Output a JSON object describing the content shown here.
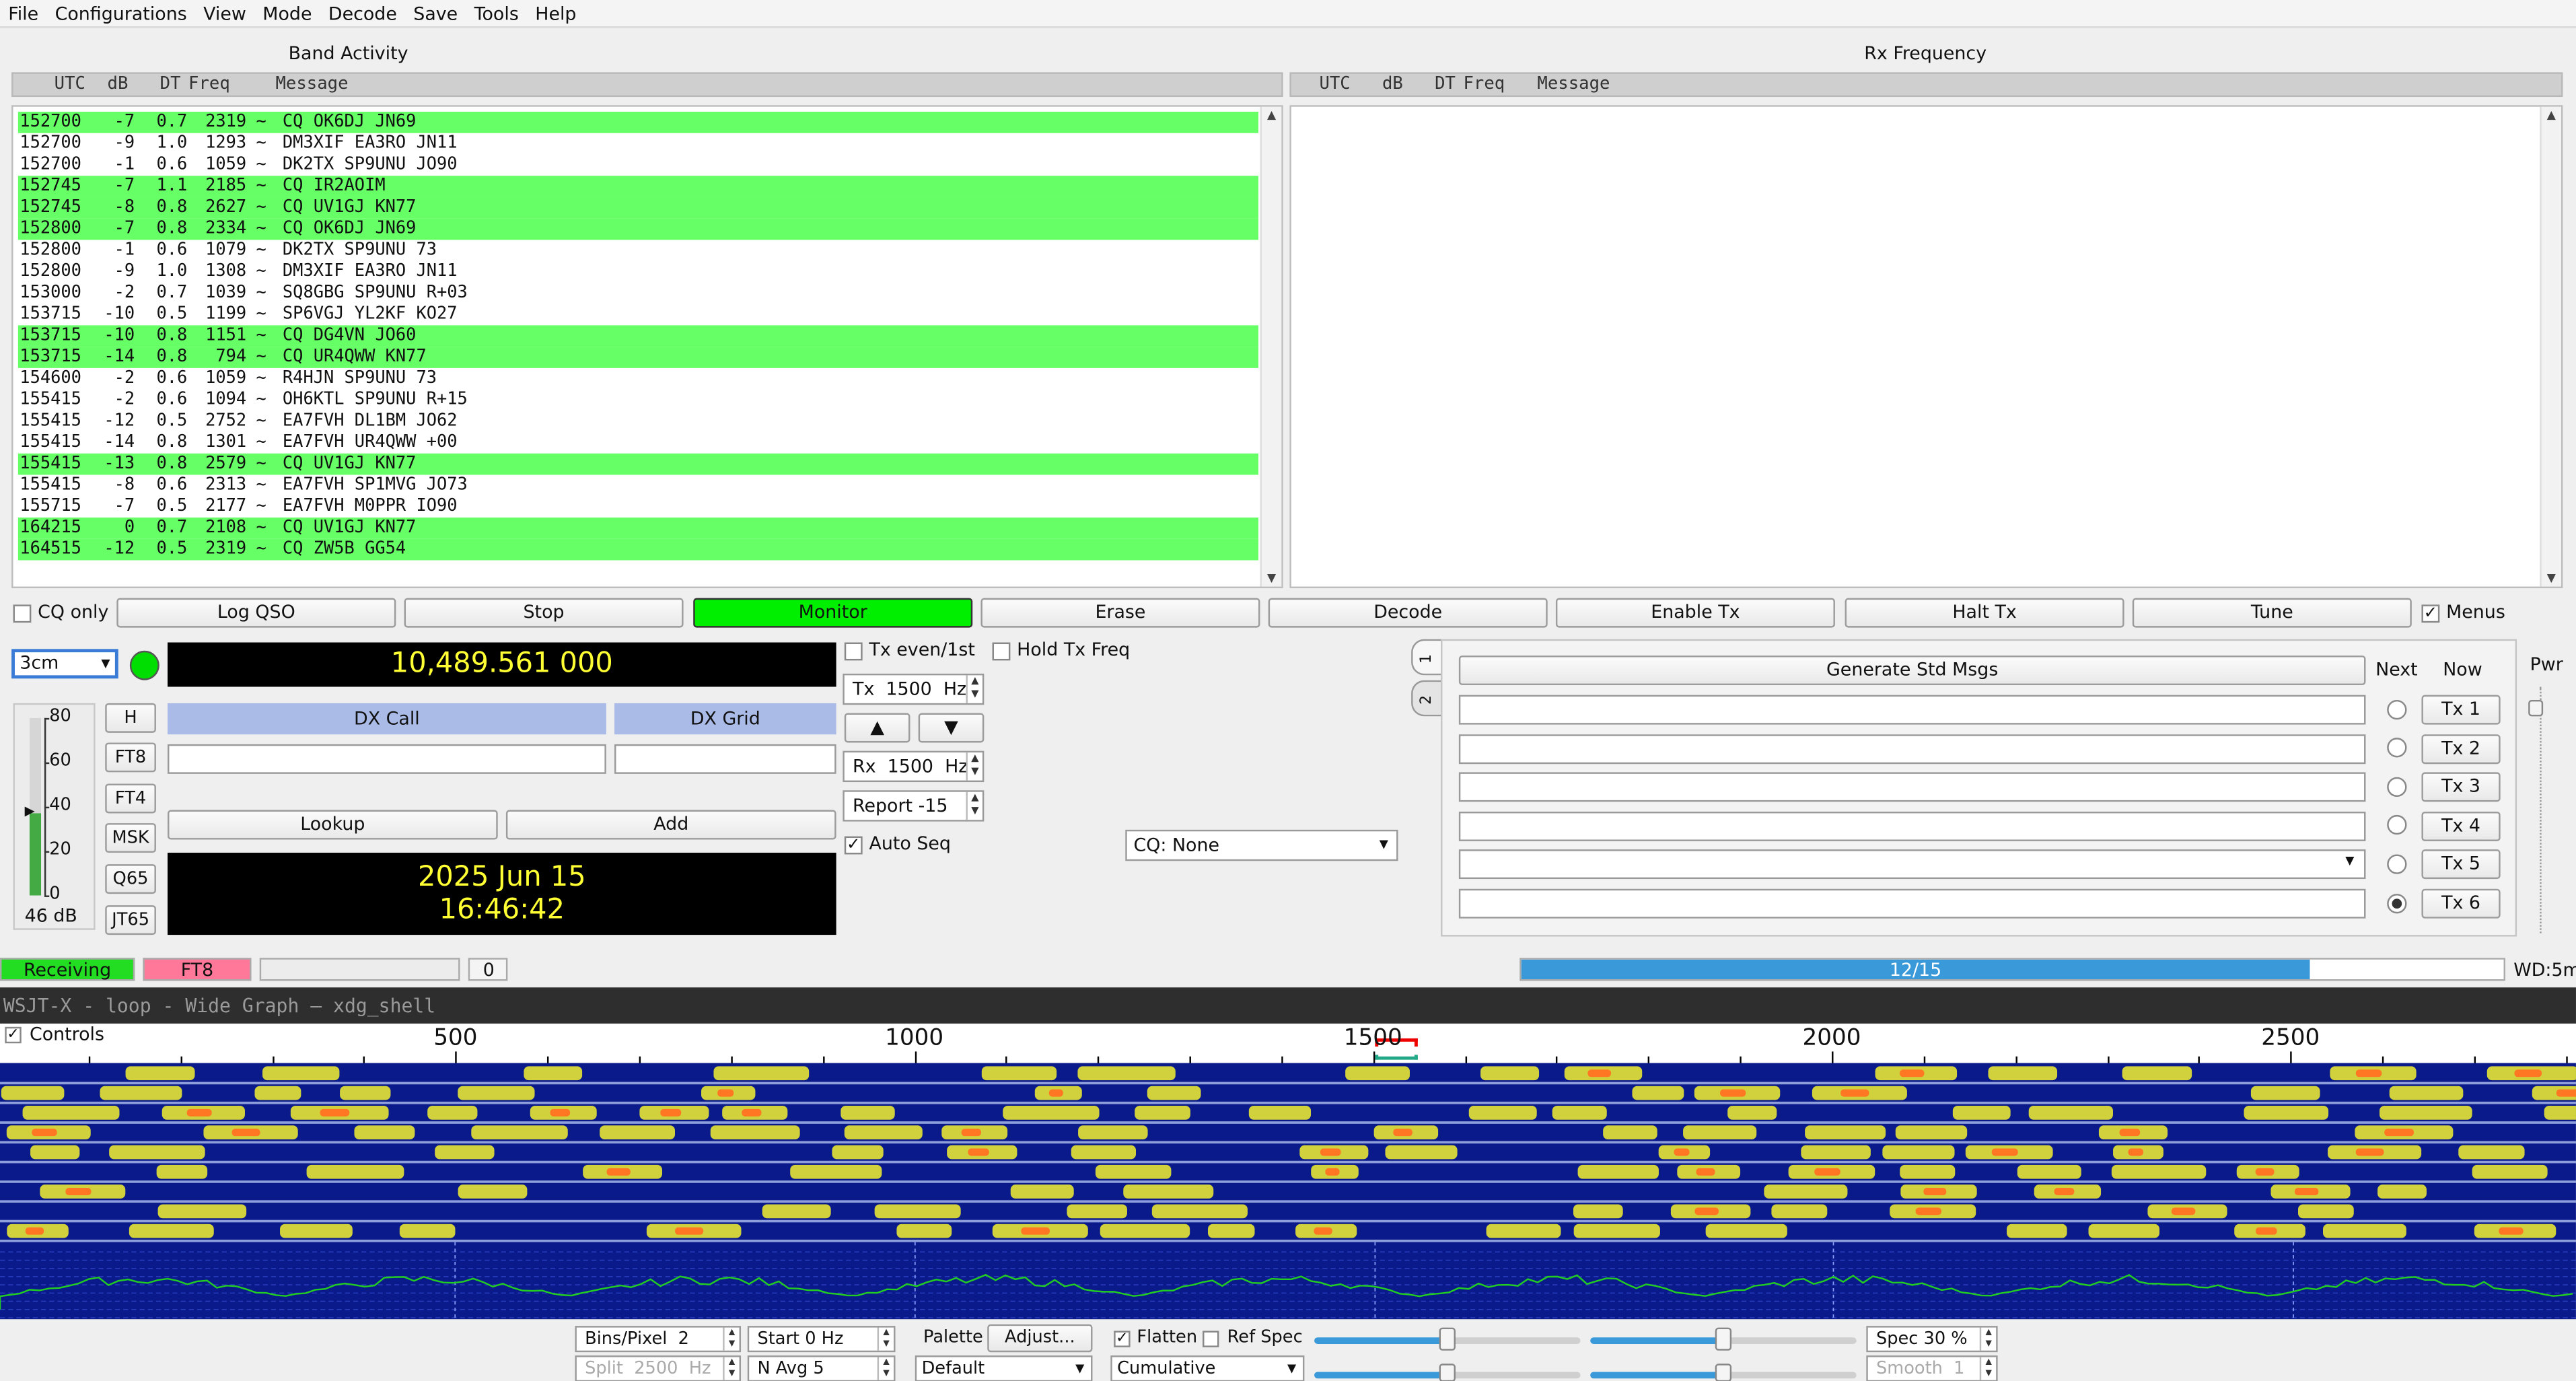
{
  "menu": [
    "File",
    "Configurations",
    "View",
    "Mode",
    "Decode",
    "Save",
    "Tools",
    "Help"
  ],
  "band_activity": {
    "title": "Band Activity",
    "headers": {
      "utc": "UTC",
      "db": "dB",
      "dt": "DT",
      "freq": "Freq",
      "message": "Message"
    },
    "rows": [
      {
        "utc": "152700",
        "db": "-7",
        "dt": "0.7",
        "freq": "2319",
        "t": "~",
        "msg": "CQ OK6DJ JN69",
        "cq": true
      },
      {
        "utc": "152700",
        "db": "-9",
        "dt": "1.0",
        "freq": "1293",
        "t": "~",
        "msg": "DM3XIF EA3RO JN11",
        "cq": false
      },
      {
        "utc": "152700",
        "db": "-1",
        "dt": "0.6",
        "freq": "1059",
        "t": "~",
        "msg": "DK2TX SP9UNU JO90",
        "cq": false
      },
      {
        "utc": "152745",
        "db": "-7",
        "dt": "1.1",
        "freq": "2185",
        "t": "~",
        "msg": "CQ IR2AOIM",
        "cq": true
      },
      {
        "utc": "152745",
        "db": "-8",
        "dt": "0.8",
        "freq": "2627",
        "t": "~",
        "msg": "CQ UV1GJ KN77",
        "cq": true
      },
      {
        "utc": "152800",
        "db": "-7",
        "dt": "0.8",
        "freq": "2334",
        "t": "~",
        "msg": "CQ OK6DJ JN69",
        "cq": true
      },
      {
        "utc": "152800",
        "db": "-1",
        "dt": "0.6",
        "freq": "1079",
        "t": "~",
        "msg": "DK2TX SP9UNU 73",
        "cq": false
      },
      {
        "utc": "152800",
        "db": "-9",
        "dt": "1.0",
        "freq": "1308",
        "t": "~",
        "msg": "DM3XIF EA3RO JN11",
        "cq": false
      },
      {
        "utc": "153000",
        "db": "-2",
        "dt": "0.7",
        "freq": "1039",
        "t": "~",
        "msg": "SQ8GBG SP9UNU R+03",
        "cq": false
      },
      {
        "utc": "153715",
        "db": "-10",
        "dt": "0.5",
        "freq": "1199",
        "t": "~",
        "msg": "SP6VGJ YL2KF KO27",
        "cq": false
      },
      {
        "utc": "153715",
        "db": "-10",
        "dt": "0.8",
        "freq": "1151",
        "t": "~",
        "msg": "CQ DG4VN JO60",
        "cq": true
      },
      {
        "utc": "153715",
        "db": "-14",
        "dt": "0.8",
        "freq": "794",
        "t": "~",
        "msg": "CQ UR4QWW KN77",
        "cq": true
      },
      {
        "utc": "154600",
        "db": "-2",
        "dt": "0.6",
        "freq": "1059",
        "t": "~",
        "msg": "R4HJN SP9UNU 73",
        "cq": false
      },
      {
        "utc": "155415",
        "db": "-2",
        "dt": "0.6",
        "freq": "1094",
        "t": "~",
        "msg": "OH6KTL SP9UNU R+15",
        "cq": false
      },
      {
        "utc": "155415",
        "db": "-12",
        "dt": "0.5",
        "freq": "2752",
        "t": "~",
        "msg": "EA7FVH DL1BM JO62",
        "cq": false
      },
      {
        "utc": "155415",
        "db": "-14",
        "dt": "0.8",
        "freq": "1301",
        "t": "~",
        "msg": "EA7FVH UR4QWW +00",
        "cq": false
      },
      {
        "utc": "155415",
        "db": "-13",
        "dt": "0.8",
        "freq": "2579",
        "t": "~",
        "msg": "CQ UV1GJ KN77",
        "cq": true
      },
      {
        "utc": "155415",
        "db": "-8",
        "dt": "0.6",
        "freq": "2313",
        "t": "~",
        "msg": "EA7FVH SP1MVG JO73",
        "cq": false
      },
      {
        "utc": "155715",
        "db": "-7",
        "dt": "0.5",
        "freq": "2177",
        "t": "~",
        "msg": "EA7FVH M0PPR IO90",
        "cq": false
      },
      {
        "utc": "164215",
        "db": "0",
        "dt": "0.7",
        "freq": "2108",
        "t": "~",
        "msg": "CQ UV1GJ KN77",
        "cq": true
      },
      {
        "utc": "164515",
        "db": "-12",
        "dt": "0.5",
        "freq": "2319",
        "t": "~",
        "msg": "CQ ZW5B GG54",
        "cq": true
      }
    ]
  },
  "rx_frequency": {
    "title": "Rx Frequency",
    "headers": {
      "utc": "UTC",
      "db": "dB",
      "dt": "DT",
      "freq": "Freq",
      "message": "Message"
    }
  },
  "controls": {
    "cq_only": "CQ only",
    "log_qso": "Log QSO",
    "stop": "Stop",
    "monitor": "Monitor",
    "erase": "Erase",
    "decode": "Decode",
    "enable_tx": "Enable Tx",
    "halt_tx": "Halt Tx",
    "tune": "Tune",
    "menus": "Menus"
  },
  "band": "3cm",
  "frequency": "10,489.561 000",
  "level": {
    "ticks": [
      "80",
      "60",
      "40",
      "20",
      "0"
    ],
    "value": "46 dB",
    "fraction": 0.46
  },
  "modes": [
    "H",
    "FT8",
    "FT4",
    "MSK",
    "Q65",
    "JT65"
  ],
  "dx": {
    "call_label": "DX Call",
    "grid_label": "DX Grid",
    "call": "",
    "grid": "",
    "lookup": "Lookup",
    "add": "Add"
  },
  "datetime": {
    "date": "2025 Jun 15",
    "time": "16:46:42"
  },
  "tx": {
    "even_label": "Tx even/1st",
    "hold_label": "Hold Tx Freq",
    "tx_hz": "Tx  1500  Hz",
    "up": "▲",
    "down": "▼",
    "rx_hz": "Rx  1500  Hz",
    "report": "Report -15",
    "auto_seq": "Auto Seq",
    "cq_select": "CQ: None"
  },
  "tabs": [
    "1",
    "2"
  ],
  "std_msgs": {
    "generate": "Generate Std Msgs",
    "next": "Next",
    "now": "Now",
    "pwr": "Pwr",
    "tx_buttons": [
      "Tx 1",
      "Tx 2",
      "Tx 3",
      "Tx 4",
      "Tx 5",
      "Tx 6"
    ]
  },
  "status": {
    "receiving": "Receiving",
    "mode": "FT8",
    "count": "0",
    "progress_label": "12/15",
    "progress_fraction": 0.8,
    "wd": "WD:5m"
  },
  "wide_graph": {
    "title": "WSJT-X - loop - Wide Graph — xdg_shell",
    "controls_label": "Controls",
    "scale_labels": [
      "500",
      "1000",
      "1500",
      "2000",
      "2500"
    ],
    "bins": "Bins/Pixel  2",
    "start": "Start 0 Hz",
    "split": "Split  2500  Hz",
    "navg": "N Avg 5",
    "palette": "Palette",
    "adjust": "Adjust...",
    "palette_value": "Default",
    "flatten": "Flatten",
    "ref_spec": "Ref Spec",
    "cumulative": "Cumulative",
    "spec": "Spec 30 %",
    "smooth": "Smooth  1"
  },
  "colors": {
    "cq_highlight": "#66ff66",
    "monitor": "#00ee00",
    "receiving": "#22dd22",
    "mode_badge": "#ff7799",
    "progress": "#3a9ad9",
    "display_bg": "#000000",
    "display_text": "#ffff33"
  }
}
